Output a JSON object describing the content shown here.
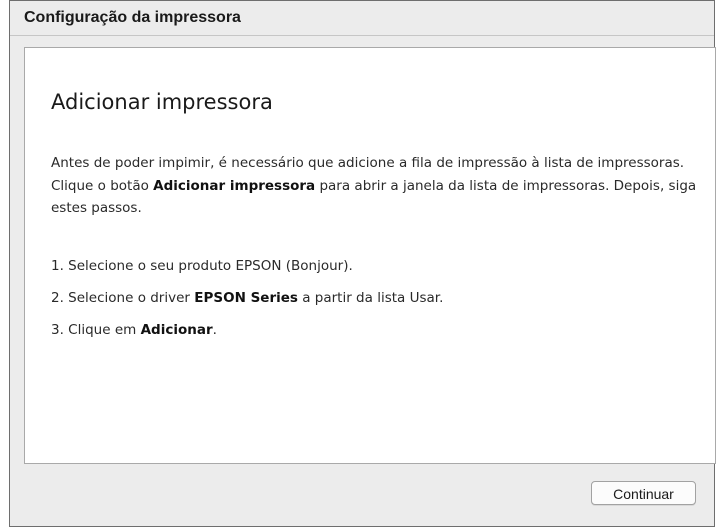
{
  "window": {
    "title": "Configuração da impressora"
  },
  "content": {
    "title": "Adicionar impressora",
    "intro": {
      "before": "Antes de poder impimir, é necessário que adicione a fila de impressão à lista de impressoras. Clique o botão ",
      "bold": "Adicionar impressora",
      "after": " para abrir a janela da lista de impressoras. Depois, siga estes passos."
    },
    "steps": [
      {
        "text": "1. Selecione o seu produto EPSON (Bonjour)."
      },
      {
        "before": "2. Selecione o driver ",
        "bold": "EPSON Series",
        "after": " a partir da lista Usar."
      },
      {
        "before": "3. Clique em ",
        "bold": "Adicionar",
        "after": "."
      }
    ]
  },
  "footer": {
    "continue_label": "Continuar"
  }
}
